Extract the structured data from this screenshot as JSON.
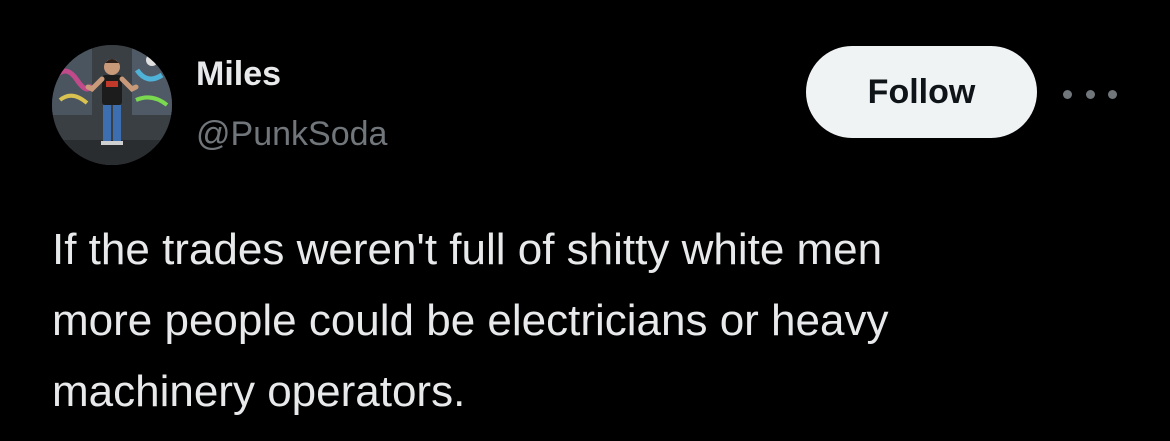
{
  "post": {
    "author": {
      "display_name": "Miles",
      "handle": "@PunkSoda",
      "avatar_icon": "profile-photo"
    },
    "follow_label": "Follow",
    "more_icon": "more-horizontal-icon",
    "text_lines": [
      "If the trades weren't full of shitty white men",
      "more people could be electricians or heavy",
      "machinery operators."
    ]
  },
  "colors": {
    "background": "#000000",
    "primary_text": "#e7e9ea",
    "secondary_text": "#71767b",
    "follow_button_bg": "#eff3f4",
    "follow_button_text": "#0f1419"
  }
}
